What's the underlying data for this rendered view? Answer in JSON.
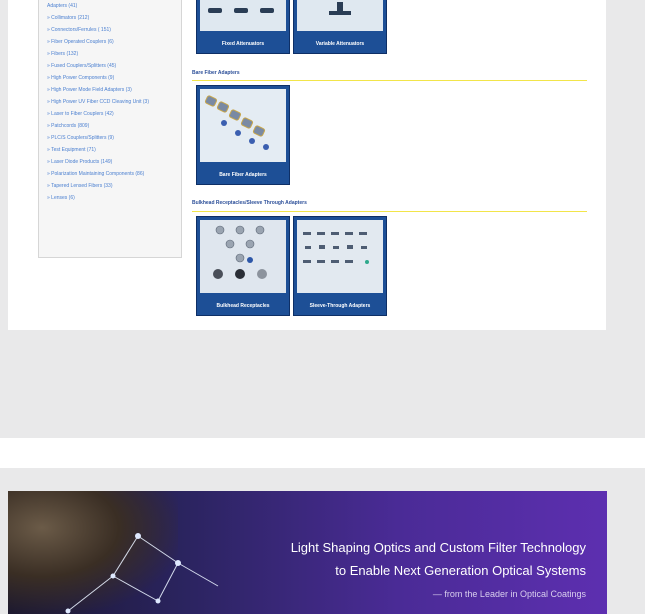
{
  "sidebar": {
    "items": [
      "Adapters (41)",
      "» Collimators (212)",
      "» Connectors/Ferrules ( 151)",
      "» Fiber Operated Couplers (6)",
      "» Fibers (132)",
      "» Fused Couplers/Splitters (45)",
      "» High Power Components (9)",
      "» High Power Mode Field Adapters (3)",
      "» High Power UV Fiber CCD Cleaving Unit (3)",
      "» Laser to Fiber Couplers (42)",
      "» Patchcords (809)",
      "» PLC/S Couplers/Splitters (9)",
      "» Test Equipment (71)",
      "» Laser Diode Products (149)",
      "» Polarization Maintaining Components (86)",
      "» Tapered Lensed Fibers (33)",
      "» Lenses (6)"
    ]
  },
  "sections": {
    "bare_title": "Bare Fiber Adapters",
    "bulkhead_title": "Bulkhead Receptacles/Sleeve Through Adapters"
  },
  "cards": {
    "fixed": "Fixed Attenuators",
    "variable": "Variable Attenuators",
    "bare": "Bare Fiber Adapters",
    "bulkhead": "Bulkhead Receptacles",
    "sleeve": "Sleeve-Through Adapters"
  },
  "banner": {
    "line1": "Light Shaping Optics and Custom Filter Technology",
    "line2": "to Enable Next Generation Optical Systems",
    "line3": "— from the Leader in Optical Coatings"
  }
}
